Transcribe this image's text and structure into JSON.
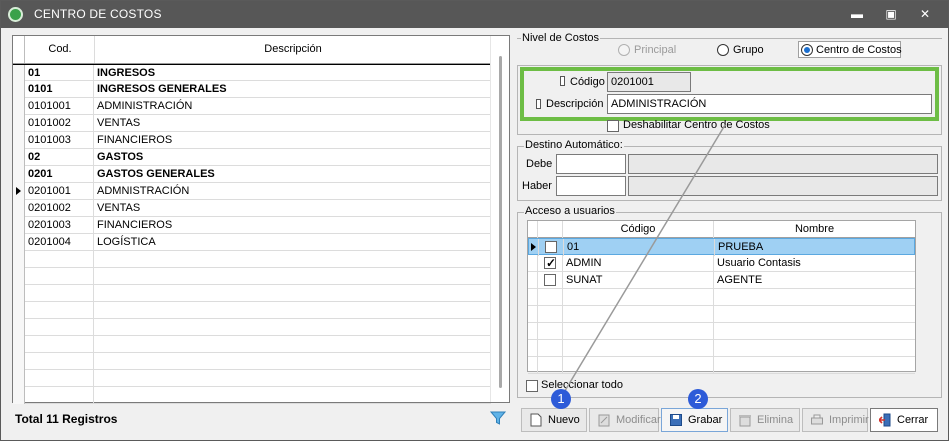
{
  "window": {
    "title": "CENTRO DE COSTOS",
    "minimize_glyph": "▬",
    "maximize_glyph": "▣",
    "close_glyph": "✕"
  },
  "grid": {
    "columns": [
      "Cod.",
      "Descripción"
    ],
    "rows": [
      {
        "code": "01",
        "desc": "INGRESOS",
        "bold": true
      },
      {
        "code": "0101",
        "desc": "INGRESOS GENERALES",
        "bold": true
      },
      {
        "code": "0101001",
        "desc": "ADMINISTRACIÓN",
        "bold": false
      },
      {
        "code": "0101002",
        "desc": "VENTAS",
        "bold": false
      },
      {
        "code": "0101003",
        "desc": "FINANCIEROS",
        "bold": false
      },
      {
        "code": "02",
        "desc": "GASTOS",
        "bold": true
      },
      {
        "code": "0201",
        "desc": "GASTOS GENERALES",
        "bold": true
      },
      {
        "code": "0201001",
        "desc": "ADMNISTRACIÓN",
        "bold": false,
        "current": true
      },
      {
        "code": "0201002",
        "desc": "VENTAS",
        "bold": false
      },
      {
        "code": "0201003",
        "desc": "FINANCIEROS",
        "bold": false
      },
      {
        "code": "0201004",
        "desc": "LOGÍSTICA",
        "bold": false
      }
    ],
    "empty_rows": 9,
    "total_label": "Total 11 Registros"
  },
  "nivel": {
    "legend": "Nivel de Costos",
    "options": [
      {
        "label": "Principal",
        "checked": false,
        "disabled": true
      },
      {
        "label": "Grupo",
        "checked": false,
        "disabled": false
      },
      {
        "label": "Centro de Costos",
        "checked": true,
        "disabled": false
      }
    ]
  },
  "form": {
    "codigo_label": "Código",
    "codigo_value": "0201001",
    "descripcion_label": "Descripción",
    "descripcion_value": "ADMINISTRACIÓN",
    "deshabilitar_label": "Deshabilitar Centro de Costos",
    "deshabilitar_checked": false
  },
  "destino": {
    "legend": "Destino Automático:",
    "debe_label": "Debe",
    "haber_label": "Haber"
  },
  "acceso": {
    "legend": "Acceso a usuarios",
    "columns": [
      "Código",
      "Nombre"
    ],
    "rows": [
      {
        "checked": false,
        "code": "01",
        "name": "PRUEBA",
        "selected": true
      },
      {
        "checked": true,
        "code": "ADMIN",
        "name": "Usuario Contasis",
        "selected": false
      },
      {
        "checked": false,
        "code": "SUNAT",
        "name": "AGENTE",
        "selected": false
      }
    ],
    "empty_rows": 5,
    "select_all_label": "Seleccionar todo",
    "select_all_checked": false
  },
  "toolbar": {
    "nuevo": "Nuevo",
    "modificar": "Modificar",
    "grabar": "Grabar",
    "elimina": "Elimina",
    "imprimir": "Imprimir",
    "cerrar": "Cerrar"
  },
  "annotations": {
    "badge_1": "1",
    "badge_2": "2",
    "highlight_color": "#6dbd45",
    "badge_color": "#2d5bd8"
  },
  "colors": {
    "titlebar": "#575757",
    "selected_row": "#9fd0f3",
    "radio_accent": "#1a6fd0"
  }
}
